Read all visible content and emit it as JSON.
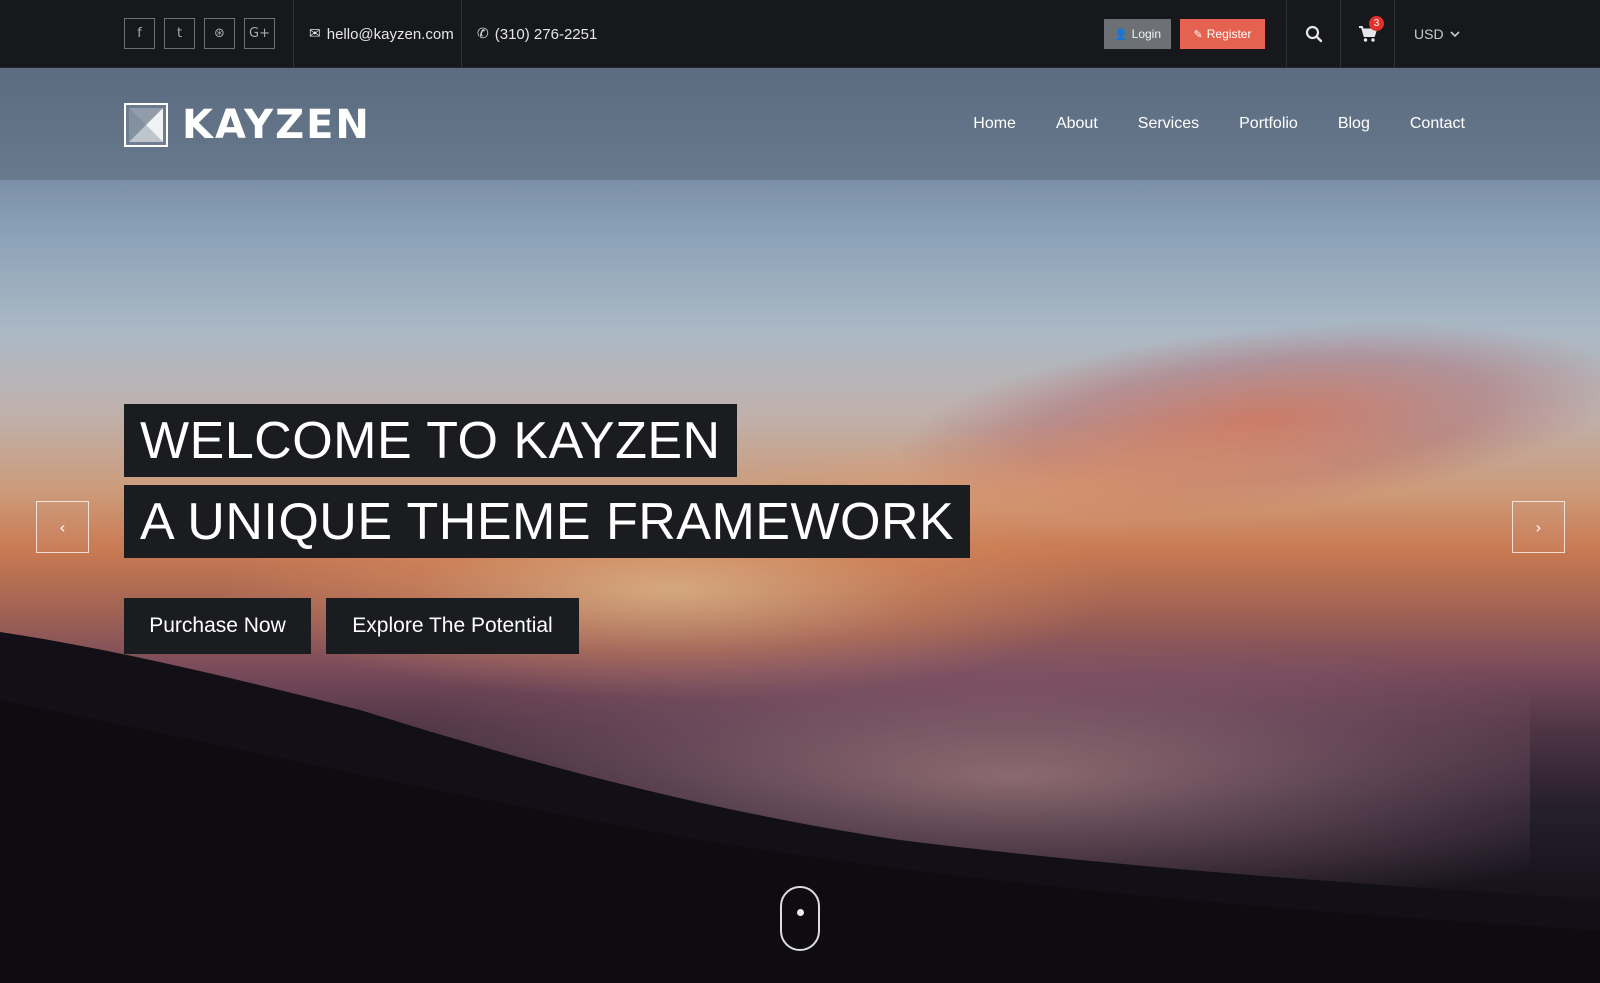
{
  "topbar": {
    "social": [
      {
        "name": "facebook",
        "glyph": "f"
      },
      {
        "name": "twitter",
        "glyph": "t"
      },
      {
        "name": "dribbble",
        "glyph": "⊛"
      },
      {
        "name": "google-plus",
        "glyph": "G+"
      }
    ],
    "email": "hello@kayzen.com",
    "phone": "(310) 276-2251",
    "login_label": "Login",
    "register_label": "Register",
    "cart_count": "3",
    "currency": "USD"
  },
  "brand": {
    "name": "KAYZEN"
  },
  "nav": {
    "items": [
      "Home",
      "About",
      "Services",
      "Portfolio",
      "Blog",
      "Contact"
    ]
  },
  "hero": {
    "line1": "WELCOME TO KAYZEN",
    "line2": "A UNIQUE THEME FRAMEWORK",
    "primary_cta": "Purchase Now",
    "secondary_cta": "Explore The Potential",
    "prev_glyph": "‹",
    "next_glyph": "›"
  },
  "colors": {
    "topbar_bg": "#16181b",
    "register_accent": "#e4624f",
    "login_bg": "#6d7176",
    "badge_red": "#e4302a"
  }
}
